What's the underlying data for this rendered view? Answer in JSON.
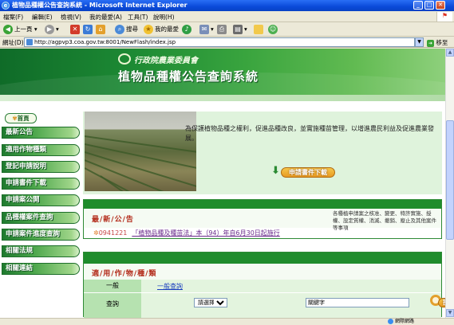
{
  "window": {
    "title": "植物品種權公告查詢系統 - Microsoft Internet Explorer",
    "minimize_glyph": "_",
    "maximize_glyph": "□",
    "close_glyph": "✕"
  },
  "menu": [
    "檔案(F)",
    "編輯(E)",
    "檢視(V)",
    "我的最愛(A)",
    "工具(T)",
    "說明(H)"
  ],
  "toolbar": {
    "back_label": "上一頁",
    "search_label": "搜尋",
    "favorites_label": "我的最愛"
  },
  "address": {
    "label": "網址(D)",
    "url": "http://agpvp3.coa.gov.tw:8001/NewFlash/index.jsp",
    "go_label": "移至"
  },
  "banner": {
    "agency": "行政院農業委員會",
    "system_title": "植物品種權公告查詢系統"
  },
  "sidebar": {
    "home_label": "首頁",
    "items": [
      "最新公告",
      "適用作物種類",
      "登記申請說明",
      "申請書件下載",
      "申請案公開",
      "品種權案件查詢",
      "申請案件進度查詢",
      "相關法規",
      "相關連結"
    ]
  },
  "intro": {
    "text": "為保護植物品種之權利，促進品種改良，並實施種苗管理，以增進農民利益及促進農業發展。",
    "download_button": "申請書件下載"
  },
  "news": {
    "heading": "最/新/公/告",
    "description": "各種植申請案之核准、變更、特許實施、授權、設定質權、消滅、撤銷、廢止及其他案件等事項",
    "items": [
      {
        "date": "0941221",
        "title": "「植物品種及種苗法」本（94）年自6月30日起施行"
      }
    ]
  },
  "crop_query": {
    "heading": "適/用/作/物/種/類",
    "general_label": "一般",
    "general_link": "一般查詢",
    "query_label": "查詢",
    "select_value": "請選擇",
    "keyword_value": "關鍵字",
    "search_button": "搜尋"
  },
  "status": {
    "zone": "網際網路"
  }
}
